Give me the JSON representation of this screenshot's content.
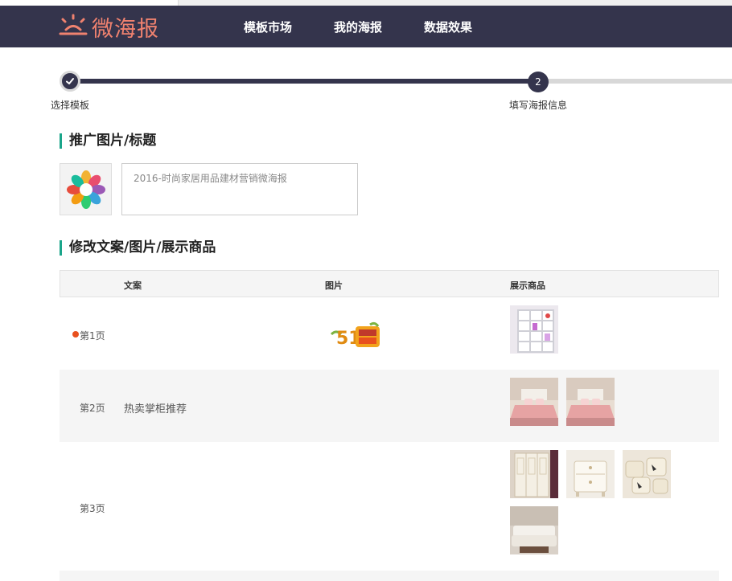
{
  "app": {
    "logo_text": "微海报"
  },
  "nav": {
    "items": [
      "模板市场",
      "我的海报",
      "数据效果"
    ]
  },
  "steps": [
    {
      "label": "选择模板",
      "status": "done"
    },
    {
      "label": "填写海报信息",
      "status": "current",
      "number": "2"
    }
  ],
  "promo": {
    "section_title": "推广图片/标题",
    "title_value": "2016-时尚家居用品建材营销微海报"
  },
  "content": {
    "section_title": "修改文案/图片/展示商品",
    "columns": [
      "文案",
      "图片",
      "展示商品"
    ],
    "rows": [
      {
        "page": "第1页",
        "copy": "",
        "active": true,
        "image": "51-sale-banner-image",
        "products": [
          "bookshelf-product-image"
        ]
      },
      {
        "page": "第2页",
        "copy": "热卖掌柜推荐",
        "active": false,
        "image": "",
        "products": [
          "pink-bed-product-image",
          "pink-bed-product-image"
        ]
      },
      {
        "page": "第3页",
        "copy": "",
        "active": false,
        "image": "",
        "products": [
          "wardrobe-product-image",
          "nightstand-product-image",
          "cushion-product-image",
          "sofa-product-image"
        ]
      }
    ]
  },
  "colors": {
    "navbar": "#34344c",
    "logo": "#f0826f",
    "section_accent": "#1aa58a",
    "active_dot": "#e8501e"
  }
}
